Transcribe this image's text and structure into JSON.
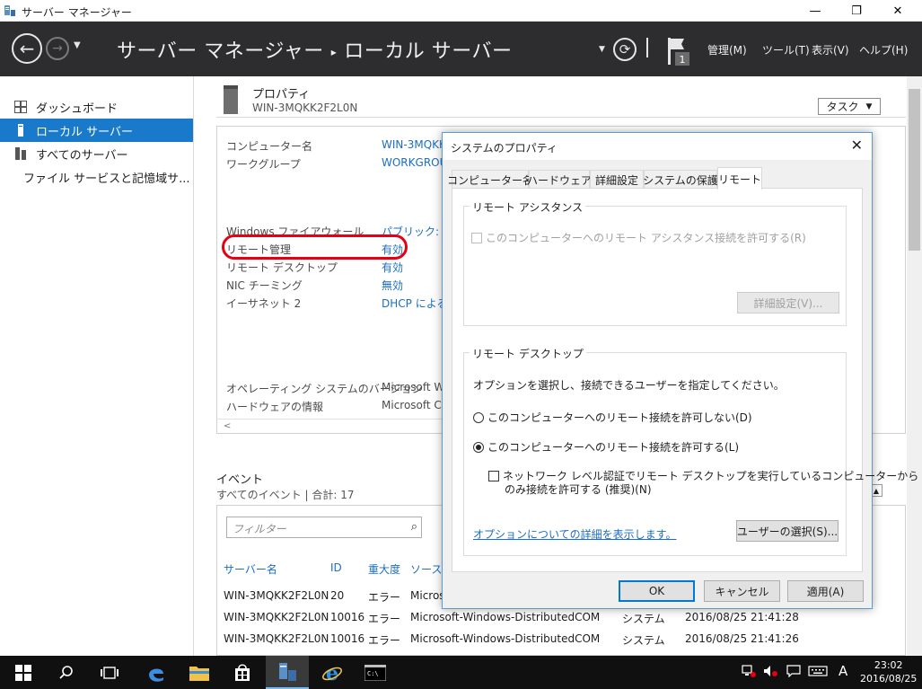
{
  "window": {
    "title": "サーバー マネージャー",
    "minimize": "—",
    "maximize": "❐",
    "close": "✕"
  },
  "header": {
    "breadcrumb_root": "サーバー マネージャー",
    "breadcrumb_sep": "▸",
    "breadcrumb_current": "ローカル サーバー",
    "flag_badge": "1",
    "menu": {
      "manage": "管理(M)",
      "tools": "ツール(T)",
      "view": "表示(V)",
      "help": "ヘルプ(H)"
    }
  },
  "sidebar": {
    "items": [
      {
        "label": "ダッシュボード"
      },
      {
        "label": "ローカル サーバー"
      },
      {
        "label": "すべてのサーバー"
      },
      {
        "label": "ファイル サービスと記憶域サ..."
      }
    ],
    "expand_arrow": "▶"
  },
  "properties": {
    "title": "プロパティ",
    "subtitle": "WIN-3MQKK2F2L0N",
    "task_button": "タスク",
    "rows": [
      {
        "label": "コンピューター名",
        "value": "WIN-3MQKK"
      },
      {
        "label": "ワークグループ",
        "value": "WORKGROU"
      },
      {
        "label": "Windows ファイアウォール",
        "value": "パブリック: 有効"
      },
      {
        "label": "リモート管理",
        "value": "有効"
      },
      {
        "label": "リモート デスクトップ",
        "value": "有効"
      },
      {
        "label": "NIC チーミング",
        "value": "無効"
      },
      {
        "label": "イーサネット 2",
        "value": "DHCP による割"
      },
      {
        "label": "オペレーティング システムのバージョン",
        "value": "Microsoft Wi"
      },
      {
        "label": "ハードウェアの情報",
        "value": "Microsoft Co"
      }
    ],
    "scroll_left": "<"
  },
  "events": {
    "title": "イベント",
    "subtitle": "すべてのイベント | 合計: 17",
    "filter_placeholder": "フィルター",
    "columns": [
      "サーバー名",
      "ID",
      "重大度",
      "ソース"
    ],
    "rows": [
      {
        "server": "WIN-3MQKK2F2L0N",
        "id": "20",
        "severity": "エラー",
        "source": "Microso",
        "log": "",
        "time": ""
      },
      {
        "server": "WIN-3MQKK2F2L0N",
        "id": "10016",
        "severity": "エラー",
        "source": "Microsoft-Windows-DistributedCOM",
        "log": "システム",
        "time": "2016/08/25 21:41:28"
      },
      {
        "server": "WIN-3MQKK2F2L0N",
        "id": "10016",
        "severity": "エラー",
        "source": "Microsoft-Windows-DistributedCOM",
        "log": "システム",
        "time": "2016/08/25 21:41:26"
      }
    ]
  },
  "dialog": {
    "title": "システムのプロパティ",
    "close": "✕",
    "tabs": [
      "コンピューター名",
      "ハードウェア",
      "詳細設定",
      "システムの保護",
      "リモート"
    ],
    "assist_group": "リモート アシスタンス",
    "assist_checkbox": "このコンピューターへのリモート アシスタンス接続を許可する(R)",
    "assist_advanced": "詳細設定(V)...",
    "rdp_group": "リモート デスクトップ",
    "rdp_hint": "オプションを選択し、接続できるユーザーを指定してください。",
    "rdp_deny": "このコンピューターへのリモート接続を許可しない(D)",
    "rdp_allow": "このコンピューターへのリモート接続を許可する(L)",
    "nla_line1": "ネットワーク レベル認証でリモート デスクトップを実行しているコンピューターから",
    "nla_line2": "のみ接続を許可する (推奨)(N)",
    "options_link": "オプションについての詳細を表示します。",
    "select_users": "ユーザーの選択(S)...",
    "ok": "OK",
    "cancel": "キャンセル",
    "apply": "適用(A)"
  },
  "taskbar": {
    "ime": "A",
    "time": "23:02",
    "date": "2016/08/25"
  },
  "colors": {
    "accent": "#1979ca",
    "header_bg": "#2d2d30",
    "link": "#1b6ec2",
    "highlight_ring": "#e60012"
  }
}
